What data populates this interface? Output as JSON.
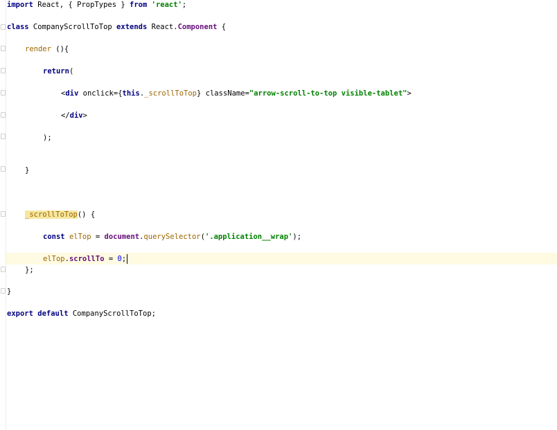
{
  "editor": {
    "lines": {
      "l1": {
        "kw1": "import",
        "t1": " React, { PropTypes } ",
        "kw2": "from",
        "t2": " ",
        "str": "'react'",
        "t3": ";"
      },
      "l2": {
        "kw1": "class",
        "t1": " CompanyScrollToTop ",
        "kw2": "extends",
        "t2": " React.",
        "comp": "Component",
        "t3": " {"
      },
      "l3": {
        "fn": "render",
        "t1": " (){"
      },
      "l4": {
        "kw": "return",
        "t1": "("
      },
      "l5": {
        "t1": "<",
        "tag": "div",
        "t2": " onclick={",
        "kw": "this",
        "t3": ".",
        "mem": "_scrollToTop",
        "t4": "} ",
        "attr": "className",
        "t5": "=",
        "str": "\"arrow-scroll-to-top visible-tablet\"",
        "t6": ">"
      },
      "l6": {
        "t1": "</",
        "tag": "div",
        "t2": ">"
      },
      "l7": {
        "t1": ");"
      },
      "l8": {
        "t1": "}"
      },
      "l9": {
        "fn": "_scrollToTop",
        "t1": "() {"
      },
      "l10": {
        "kw": "const",
        "t1": " ",
        "var": "elTop",
        "t2": " = ",
        "doc": "document",
        "t3": ".",
        "m": "querySelector",
        "t4": "(",
        "str": "'.application__wrap'",
        "t5": ");"
      },
      "l11": {
        "var": "elTop",
        "t1": ".",
        "prop": "scrollTo",
        "t2": " = ",
        "num": "0",
        "t3": ";"
      },
      "l12": {
        "t1": "};"
      },
      "l13": {
        "t1": "}"
      },
      "l14": {
        "kw1": "export",
        "t1": " ",
        "kw2": "default",
        "t2": " CompanyScrollToTop;"
      }
    }
  },
  "colors": {
    "keyword": "#000080",
    "string": "#008000",
    "caret_line": "#fffbe2",
    "highlight": "#f5e7a0"
  }
}
